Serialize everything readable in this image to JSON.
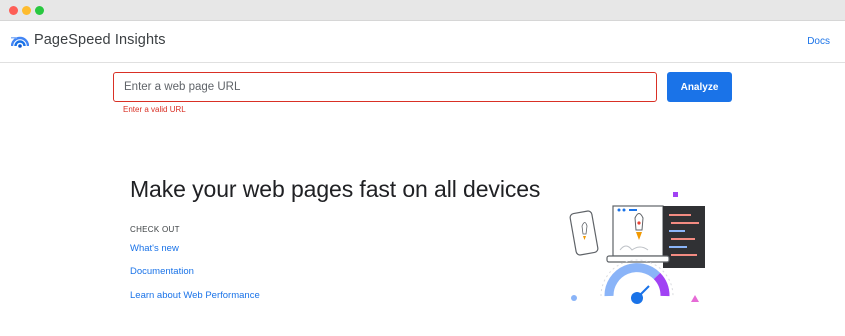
{
  "window": {
    "controls": [
      "close",
      "minimize",
      "maximize"
    ]
  },
  "header": {
    "app_title": "PageSpeed Insights",
    "docs_label": "Docs",
    "logo_icon": "pagespeed-logo-icon"
  },
  "search": {
    "placeholder": "Enter a web page URL",
    "value": "",
    "error_text": "Enter a valid URL",
    "analyze_label": "Analyze"
  },
  "main": {
    "headline": "Make your web pages fast on all devices",
    "checkout_label": "CHECK OUT",
    "links": [
      {
        "label": "What's new"
      },
      {
        "label": "Documentation"
      },
      {
        "label": "Learn about Web Performance"
      }
    ],
    "illustration_icon": "devices-speed-illustration"
  },
  "colors": {
    "accent": "#1a73e8",
    "error": "#d93025",
    "title_bar": "#e7e7e7",
    "gauge_purple": "#a142f4"
  }
}
